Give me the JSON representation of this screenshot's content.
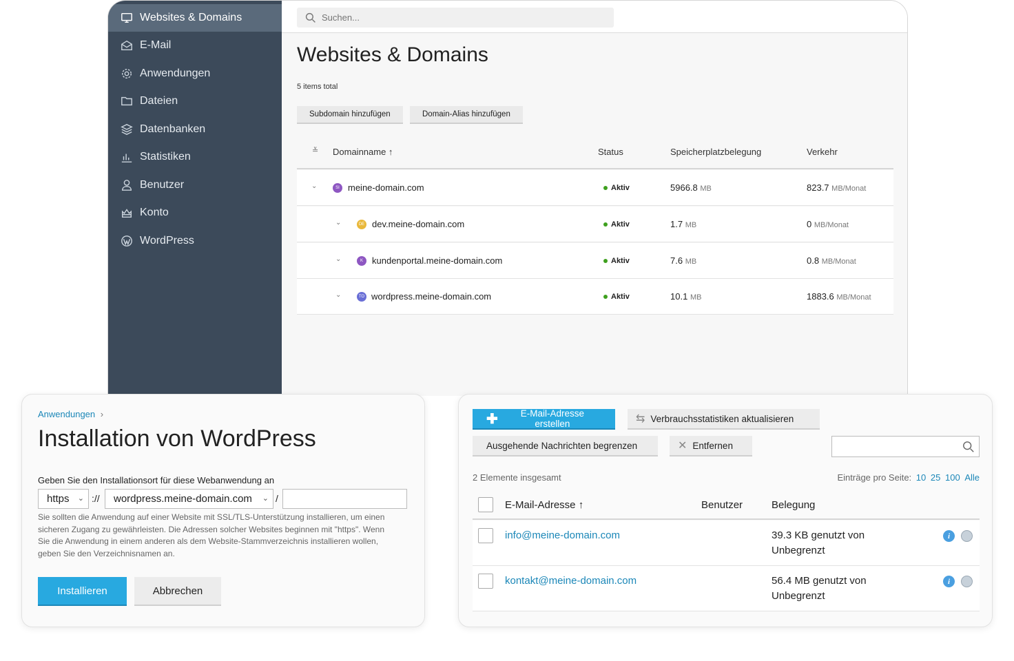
{
  "sidebar": {
    "items": [
      {
        "label": "Websites & Domains",
        "icon": "monitor-icon"
      },
      {
        "label": "E-Mail",
        "icon": "mail-icon"
      },
      {
        "label": "Anwendungen",
        "icon": "gear-icon"
      },
      {
        "label": "Dateien",
        "icon": "folder-icon"
      },
      {
        "label": "Datenbanken",
        "icon": "database-icon"
      },
      {
        "label": "Statistiken",
        "icon": "chart-icon"
      },
      {
        "label": "Benutzer",
        "icon": "user-icon"
      },
      {
        "label": "Konto",
        "icon": "account-icon"
      },
      {
        "label": "WordPress",
        "icon": "wordpress-icon"
      }
    ]
  },
  "search": {
    "placeholder": "Suchen..."
  },
  "main": {
    "title": "Websites & Domains",
    "items_total": "5 items total",
    "buttons": {
      "add_subdomain": "Subdomain hinzufügen",
      "add_alias": "Domain-Alias hinzufügen"
    },
    "columns": {
      "name": "Domainname ↑",
      "status": "Status",
      "storage": "Speicherplatzbelegung",
      "traffic": "Verkehr"
    },
    "rows": [
      {
        "name": "meine-domain.com",
        "badge": "SI",
        "badge_color": "#8e57c2",
        "status": "Aktiv",
        "storage": "5966.8",
        "storage_unit": "MB",
        "traffic": "823.7",
        "traffic_unit": "MB/Monat"
      },
      {
        "name": "dev.meine-domain.com",
        "badge": "DE",
        "badge_color": "#e9b83a",
        "status": "Aktiv",
        "storage": "1.7",
        "storage_unit": "MB",
        "traffic": "0",
        "traffic_unit": "MB/Monat"
      },
      {
        "name": "kundenportal.meine-domain.com",
        "badge": "K",
        "badge_color": "#8e57c2",
        "status": "Aktiv",
        "storage": "7.6",
        "storage_unit": "MB",
        "traffic": "0.8",
        "traffic_unit": "MB/Monat"
      },
      {
        "name": "wordpress.meine-domain.com",
        "badge": "TO",
        "badge_color": "#6a6fd6",
        "status": "Aktiv",
        "storage": "10.1",
        "storage_unit": "MB",
        "traffic": "1883.6",
        "traffic_unit": "MB/Monat"
      }
    ]
  },
  "wp_install": {
    "breadcrumb": "Anwendungen",
    "title": "Installation von WordPress",
    "location_label": "Geben Sie den Installationsort für diese Webanwendung an",
    "protocol": "https",
    "separator": "://",
    "domain": "wordpress.meine-domain.com",
    "slash": "/",
    "path": "",
    "help": "Sie sollten die Anwendung auf einer Website mit SSL/TLS-Unterstützung installieren, um einen sicheren Zugang zu gewährleisten. Die Adressen solcher Websites beginnen mit \"https\". Wenn Sie die Anwendung in einem anderen als dem Website-Stammverzeichnis installieren wollen, geben Sie den Verzeichnisnamen an.",
    "install_label": "Installieren",
    "cancel_label": "Abbrechen"
  },
  "mail": {
    "create_label": "E-Mail-Adresse erstellen",
    "update_stats_label": "Verbrauchsstatistiken aktualisieren",
    "limit_label": "Ausgehende Nachrichten begrenzen",
    "remove_label": "Entfernen",
    "count": "2 Elemente insgesamt",
    "per_page_label": "Einträge pro Seite:",
    "per_page_options": [
      "10",
      "25",
      "100",
      "Alle"
    ],
    "columns": {
      "address": "E-Mail-Adresse ↑",
      "user": "Benutzer",
      "usage": "Belegung"
    },
    "rows": [
      {
        "address": "info@meine-domain.com",
        "usage_line1": "39.3 KB genutzt von",
        "usage_line2": "Unbegrenzt"
      },
      {
        "address": "kontakt@meine-domain.com",
        "usage_line1": "56.4 MB genutzt von",
        "usage_line2": "Unbegrenzt"
      }
    ]
  }
}
